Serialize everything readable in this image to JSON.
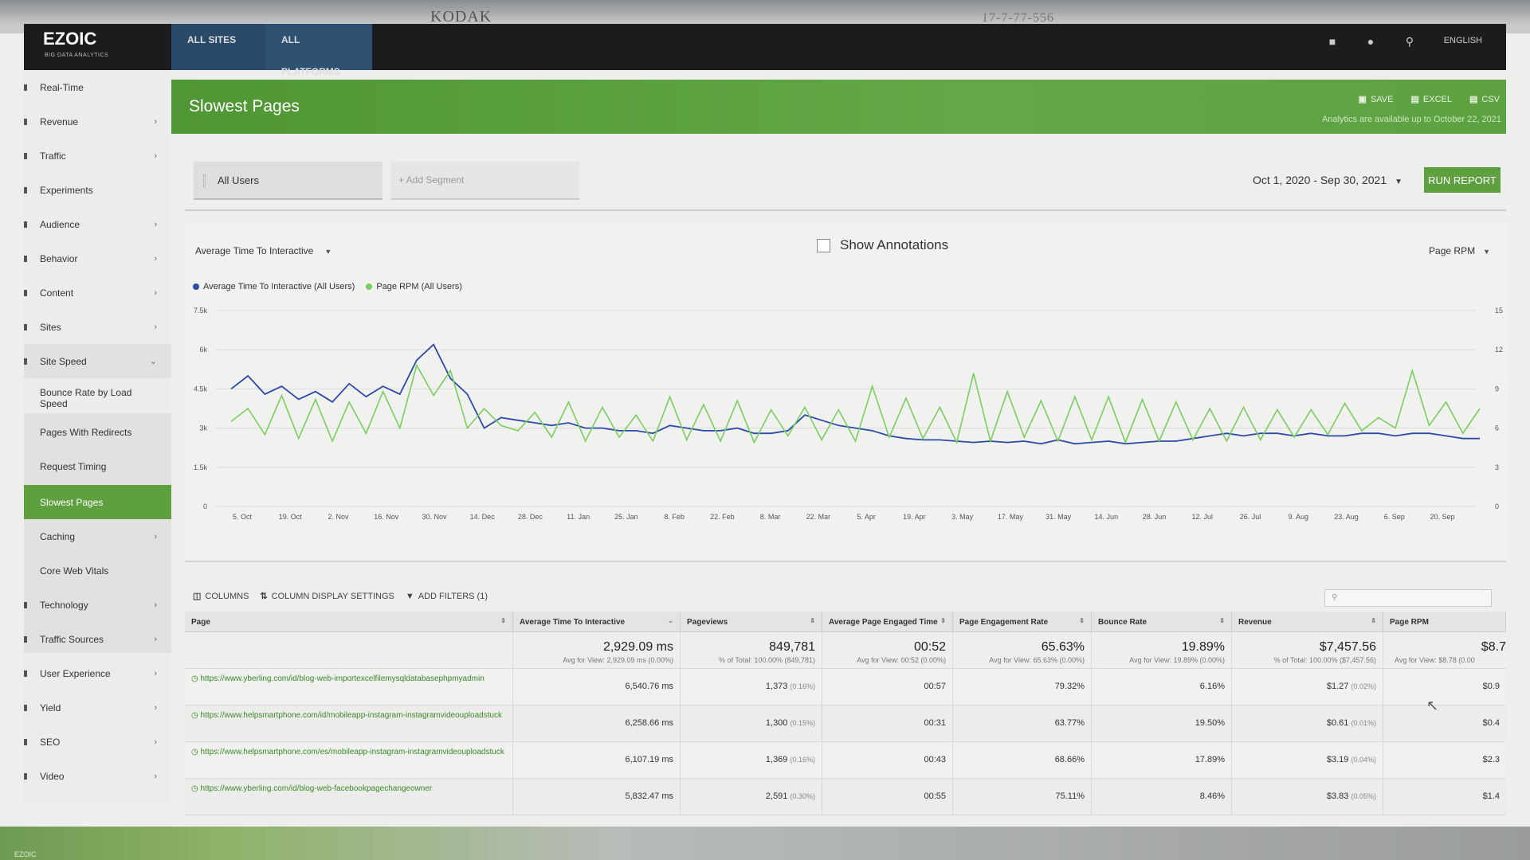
{
  "overlay": {
    "stamp": "KODAK",
    "code": "17-7-77-556"
  },
  "topnav": {
    "logo": "EZOIC",
    "logo_sub": "BIG DATA ANALYTICS",
    "tabs": [
      {
        "label": "ALL SITES"
      },
      {
        "label": "ALL PLATFORMS"
      }
    ],
    "language": "ENGLISH"
  },
  "sidebar": {
    "items": [
      {
        "label": "Real-Time"
      },
      {
        "label": "Revenue"
      },
      {
        "label": "Traffic"
      },
      {
        "label": "Experiments"
      },
      {
        "label": "Audience"
      },
      {
        "label": "Behavior"
      },
      {
        "label": "Content"
      },
      {
        "label": "Sites"
      },
      {
        "label": "Site Speed"
      },
      {
        "label": "Technology"
      },
      {
        "label": "Traffic Sources"
      },
      {
        "label": "User Experience"
      },
      {
        "label": "Yield"
      },
      {
        "label": "SEO"
      },
      {
        "label": "Video"
      }
    ],
    "site_speed_sub": [
      {
        "label": "Bounce Rate by Load Speed"
      },
      {
        "label": "Pages With Redirects"
      },
      {
        "label": "Request Timing"
      },
      {
        "label": "Slowest Pages"
      },
      {
        "label": "Caching"
      },
      {
        "label": "Core Web Vitals"
      }
    ]
  },
  "header": {
    "title": "Slowest Pages",
    "save": "SAVE",
    "excel": "EXCEL",
    "csv": "CSV",
    "note": "Analytics are available up to October 22, 2021"
  },
  "segments": {
    "segment1": "All Users",
    "add_segment": "+ Add Segment",
    "date_range": "Oct 1, 2020 - Sep 30, 2021",
    "run_report": "RUN REPORT"
  },
  "chart_controls": {
    "metric": "Average Time To Interactive",
    "show_annotations": "Show Annotations",
    "secondary_metric": "Page RPM"
  },
  "chart_data": {
    "type": "line",
    "x_ticks": [
      "5. Oct",
      "19. Oct",
      "2. Nov",
      "16. Nov",
      "30. Nov",
      "14. Dec",
      "28. Dec",
      "11. Jan",
      "25. Jan",
      "8. Feb",
      "22. Feb",
      "8. Mar",
      "22. Mar",
      "5. Apr",
      "19. Apr",
      "3. May",
      "17. May",
      "31. May",
      "14. Jun",
      "28. Jun",
      "12. Jul",
      "26. Jul",
      "9. Aug",
      "23. Aug",
      "6. Sep",
      "20. Sep"
    ],
    "y_left_ticks": [
      "0",
      "1.5k",
      "3k",
      "4.5k",
      "6k",
      "7.5k"
    ],
    "y_left_range": [
      0,
      7500
    ],
    "y_right_ticks": [
      "0",
      "3",
      "6",
      "9",
      "12",
      "15"
    ],
    "y_right_range": [
      0,
      15
    ],
    "series": [
      {
        "name": "Average Time To Interactive (All Users)",
        "axis": "left",
        "color": "#2b4ba8",
        "values": [
          4500,
          5000,
          4300,
          4600,
          4100,
          4400,
          4000,
          4700,
          4200,
          4600,
          4300,
          5600,
          6200,
          4900,
          4300,
          3000,
          3400,
          3300,
          3200,
          3100,
          3200,
          3000,
          3000,
          2900,
          2900,
          2800,
          3100,
          3000,
          2900,
          2900,
          3000,
          2800,
          2800,
          2900,
          3500,
          3300,
          3100,
          3000,
          2900,
          2700,
          2600,
          2550,
          2550,
          2500,
          2450,
          2500,
          2450,
          2500,
          2400,
          2550,
          2400,
          2450,
          2500,
          2400,
          2450,
          2500,
          2500,
          2600,
          2700,
          2800,
          2700,
          2800,
          2800,
          2700,
          2800,
          2700,
          2700,
          2800,
          2800,
          2700,
          2800,
          2800,
          2700,
          2600,
          2600
        ]
      },
      {
        "name": "Page RPM (All Users)",
        "axis": "right",
        "color": "#79cf5e",
        "values": [
          6.5,
          7.5,
          5.5,
          8.5,
          5.2,
          8.2,
          5.0,
          8.0,
          5.6,
          8.8,
          6.0,
          10.8,
          8.5,
          10.4,
          6.0,
          7.5,
          6.2,
          5.8,
          7.2,
          5.3,
          8.0,
          5.0,
          7.6,
          5.3,
          7.0,
          5.0,
          8.4,
          5.1,
          7.8,
          5.0,
          8.1,
          4.9,
          7.4,
          5.4,
          7.6,
          5.1,
          7.4,
          5.0,
          9.2,
          5.3,
          8.3,
          5.2,
          7.6,
          4.9,
          10.2,
          5.0,
          8.8,
          5.3,
          8.1,
          5.0,
          8.4,
          5.1,
          8.4,
          4.9,
          8.2,
          5.0,
          8.0,
          5.1,
          7.5,
          5.0,
          7.6,
          5.1,
          7.4,
          5.3,
          7.4,
          5.5,
          7.9,
          5.8,
          6.8,
          6.0,
          10.4,
          6.2,
          8.0,
          5.6,
          7.5
        ]
      }
    ],
    "legend": "top-left",
    "grid": true
  },
  "table": {
    "toolbar": {
      "columns": "COLUMNS",
      "column_settings": "COLUMN DISPLAY SETTINGS",
      "filters": "ADD FILTERS (1)"
    },
    "headers": [
      "Page",
      "Average Time To Interactive",
      "Pageviews",
      "Average Page Engaged Time",
      "Page Engagement Rate",
      "Bounce Rate",
      "Revenue",
      "Page RPM"
    ],
    "totals": {
      "atti": "2,929.09 ms",
      "atti_sub": "Avg for View: 2,929.09 ms (0.00%)",
      "pageviews": "849,781",
      "pageviews_sub": "% of Total: 100.00% (849,781)",
      "engaged": "00:52",
      "engaged_sub": "Avg for View: 00:52 (0.00%)",
      "eng_rate": "65.63%",
      "eng_rate_sub": "Avg for View: 65.63% (0.00%)",
      "bounce": "19.89%",
      "bounce_sub": "Avg for View: 19.89% (0.00%)",
      "revenue": "$7,457.56",
      "revenue_sub": "% of Total: 100.00% ($7,457.56)",
      "rpm": "$8.7",
      "rpm_sub": "Avg for View: $8.78 (0.00"
    },
    "rows": [
      {
        "url": "https://www.yberling.com/id/blog-web-importexcelfilemysqldatabasephpmyadmin",
        "atti": "6,540.76 ms",
        "pv": "1,373",
        "pv_pct": "(0.16%)",
        "eng": "00:57",
        "eng_rate": "79.32%",
        "bounce": "6.16%",
        "rev": "$1.27",
        "rev_pct": "(0.02%)",
        "rpm": "$0.9"
      },
      {
        "url": "https://www.helpsmartphone.com/id/mobileapp-instagram-instagramvideouploadstuck",
        "atti": "6,258.66 ms",
        "pv": "1,300",
        "pv_pct": "(0.15%)",
        "eng": "00:31",
        "eng_rate": "63.77%",
        "bounce": "19.50%",
        "rev": "$0.61",
        "rev_pct": "(0.01%)",
        "rpm": "$0.4"
      },
      {
        "url": "https://www.helpsmartphone.com/es/mobileapp-instagram-instagramvideouploadstuck",
        "atti": "6,107.19 ms",
        "pv": "1,369",
        "pv_pct": "(0.16%)",
        "eng": "00:43",
        "eng_rate": "68.66%",
        "bounce": "17.89%",
        "rev": "$3.19",
        "rev_pct": "(0.04%)",
        "rpm": "$2.3"
      },
      {
        "url": "https://www.yberling.com/id/blog-web-facebookpagechangeowner",
        "atti": "5,832.47 ms",
        "pv": "2,591",
        "pv_pct": "(0.30%)",
        "eng": "00:55",
        "eng_rate": "75.11%",
        "bounce": "8.46%",
        "rev": "$3.83",
        "rev_pct": "(0.05%)",
        "rpm": "$1.4"
      }
    ]
  }
}
